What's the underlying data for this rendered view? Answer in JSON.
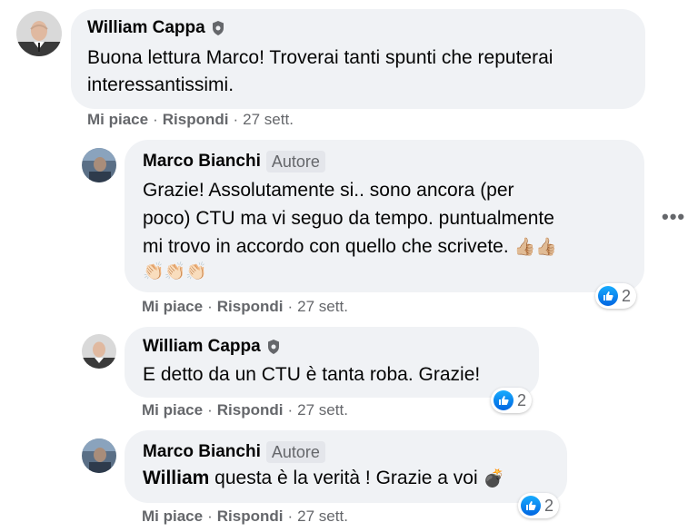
{
  "comments": [
    {
      "author": "William Cappa",
      "verified": true,
      "badge": "",
      "text_lines": [
        "Buona lettura Marco! Troverai tanti spunti che reputerai",
        "interessantissimi."
      ],
      "like_label": "Mi piace",
      "reply_label": "Rispondi",
      "time": "27 sett.",
      "reactions": ""
    },
    {
      "author": "Marco Bianchi",
      "verified": false,
      "badge": "Autore",
      "text_lines": [
        "Grazie! Assolutamente si.. sono ancora (per",
        "poco) CTU ma vi seguo da tempo. puntualmente",
        "mi trovo in accordo con quello che scrivete."
      ],
      "emoji_line_1": "👍🏼👍🏼",
      "emoji_line_2": "👏🏻👏🏻👏🏻",
      "like_label": "Mi piace",
      "reply_label": "Rispondi",
      "time": "27 sett.",
      "reactions": "2"
    },
    {
      "author": "William Cappa",
      "verified": true,
      "badge": "",
      "text_lines": [
        "E detto da un CTU è tanta roba. Grazie!"
      ],
      "like_label": "Mi piace",
      "reply_label": "Rispondi",
      "time": "27 sett.",
      "reactions": "2"
    },
    {
      "author": "Marco Bianchi",
      "verified": false,
      "badge": "Autore",
      "mention": "William",
      "text_rest": " questa è la verità ! Grazie a voi ",
      "emoji": "💣",
      "like_label": "Mi piace",
      "reply_label": "Rispondi",
      "time": "27 sett.",
      "reactions": "2"
    }
  ],
  "more_menu": "•••",
  "separator": "·",
  "colors": {
    "bubble": "#f0f2f5",
    "secondary_text": "#65676b",
    "like_blue": "#0866ff"
  }
}
